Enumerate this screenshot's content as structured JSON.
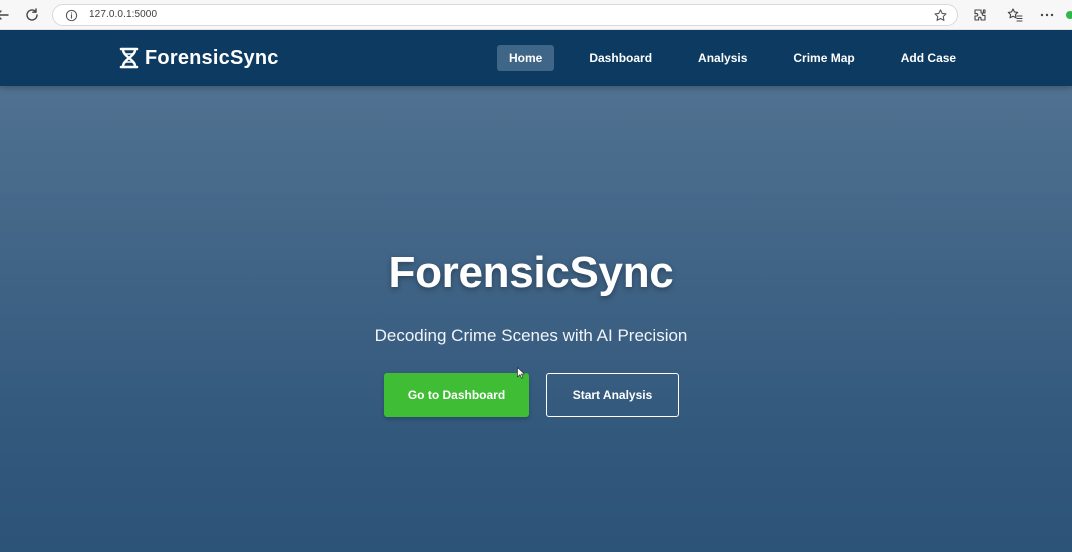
{
  "browser": {
    "url": "127.0.0.1:5000",
    "icons": [
      "back-icon",
      "reload-icon",
      "info-icon",
      "star-icon",
      "extensions-icon",
      "favorites-icon",
      "more-icon"
    ]
  },
  "nav": {
    "brand": "ForensicSync",
    "links": [
      {
        "label": "Home",
        "active": true
      },
      {
        "label": "Dashboard",
        "active": false
      },
      {
        "label": "Analysis",
        "active": false
      },
      {
        "label": "Crime Map",
        "active": false
      },
      {
        "label": "Add Case",
        "active": false
      }
    ]
  },
  "hero": {
    "title": "ForensicSync",
    "subtitle": "Decoding Crime Scenes with AI Precision",
    "primary_button": "Go to Dashboard",
    "secondary_button": "Start Analysis"
  },
  "colors": {
    "navbar": "#0d3a60",
    "active_tab": "#3f6686",
    "primary_button": "#3fbd35",
    "hero_top": "#567795",
    "hero_bottom": "#2c5378"
  }
}
